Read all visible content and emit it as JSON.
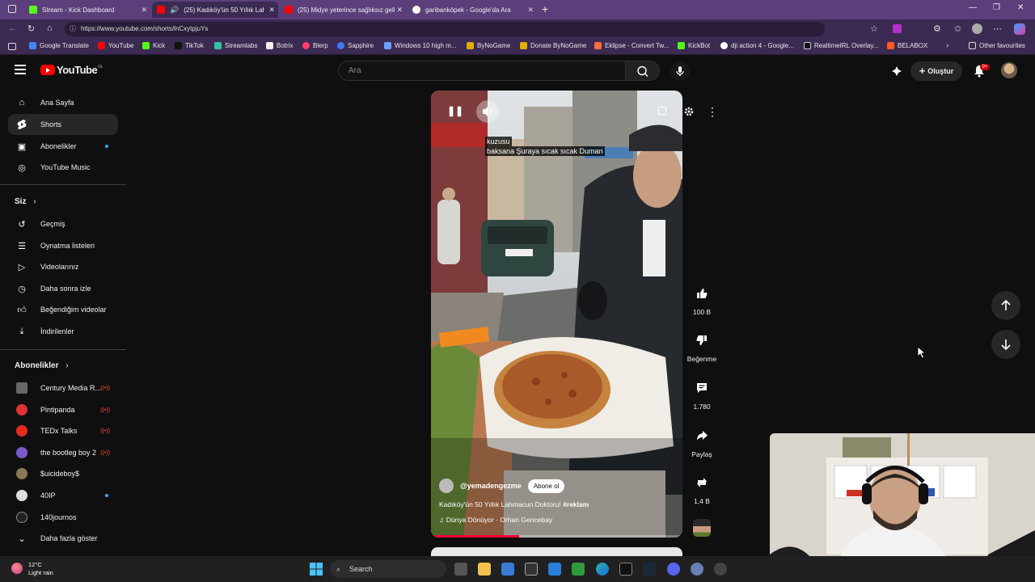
{
  "browser": {
    "tabs": [
      {
        "label": "Stream - Kick Dashboard",
        "active": false
      },
      {
        "label": "(25) Kadıköy'ün 50 Yıllık Lah",
        "active": true
      },
      {
        "label": "(25) Midye yeterince sağlıksız geli",
        "active": false
      },
      {
        "label": "garibanköpek - Google'da Ara",
        "active": false
      }
    ],
    "new_tab": "+",
    "url": "https://www.youtube.com/shorts/lnCxytpjuYs",
    "bookmarks": [
      "Google Translate",
      "YouTube",
      "Kick",
      "TikTok",
      "Streamlabs",
      "Botrix",
      "Blerp",
      "Sapphire",
      "Windows 10 high m...",
      "ByNoGame",
      "Donate ByNoGame",
      "Eklipse - Convert Tw...",
      "KickBot",
      "dji action 4 - Google...",
      "RealtimeIRL Overlay...",
      "BELABOX"
    ],
    "other_favourites": "Other favourites"
  },
  "youtube": {
    "logo_text": "YouTube",
    "logo_country": "NL",
    "search_placeholder": "Ara",
    "create_label": "Oluştur",
    "notif_count": "9+"
  },
  "sidebar": {
    "main": [
      "Ana Sayfa",
      "Shorts",
      "Abonelikler",
      "YouTube Music"
    ],
    "you_heading": "Siz",
    "you_items": [
      "Geçmiş",
      "Oynatma listeleri",
      "Videolarınız",
      "Daha sonra izle",
      "Beğendiğim videolar",
      "İndirilenler"
    ],
    "subs_heading": "Abonelikler",
    "subs": [
      "Century Media R...",
      "Pintipanda",
      "TEDx Talks",
      "the bootleg boy 2",
      "$uicideboy$",
      "40IP",
      "140journos"
    ],
    "show_more": "Daha fazla göster"
  },
  "short": {
    "caption_line1": "kuzusu",
    "caption_line2": "baksana Şuraya sıcak sıcak Duman",
    "channel": "@yemadengezme",
    "subscribe": "Abone ol",
    "title": "Kadıköy'ün 50 Yıllık Lahmacun Doktoru!",
    "hashtag": "#reklam",
    "music": "♫ Dünya Dönüyor · Orhan Gencebay",
    "progress": 0.35
  },
  "actions": {
    "likes": "100 B",
    "dislike": "Beğenme",
    "comments": "1.780",
    "share": "Paylaş",
    "remix": "1,4 B"
  },
  "taskbar": {
    "temp": "12°C",
    "weather": "Light rain",
    "search": "Search"
  }
}
